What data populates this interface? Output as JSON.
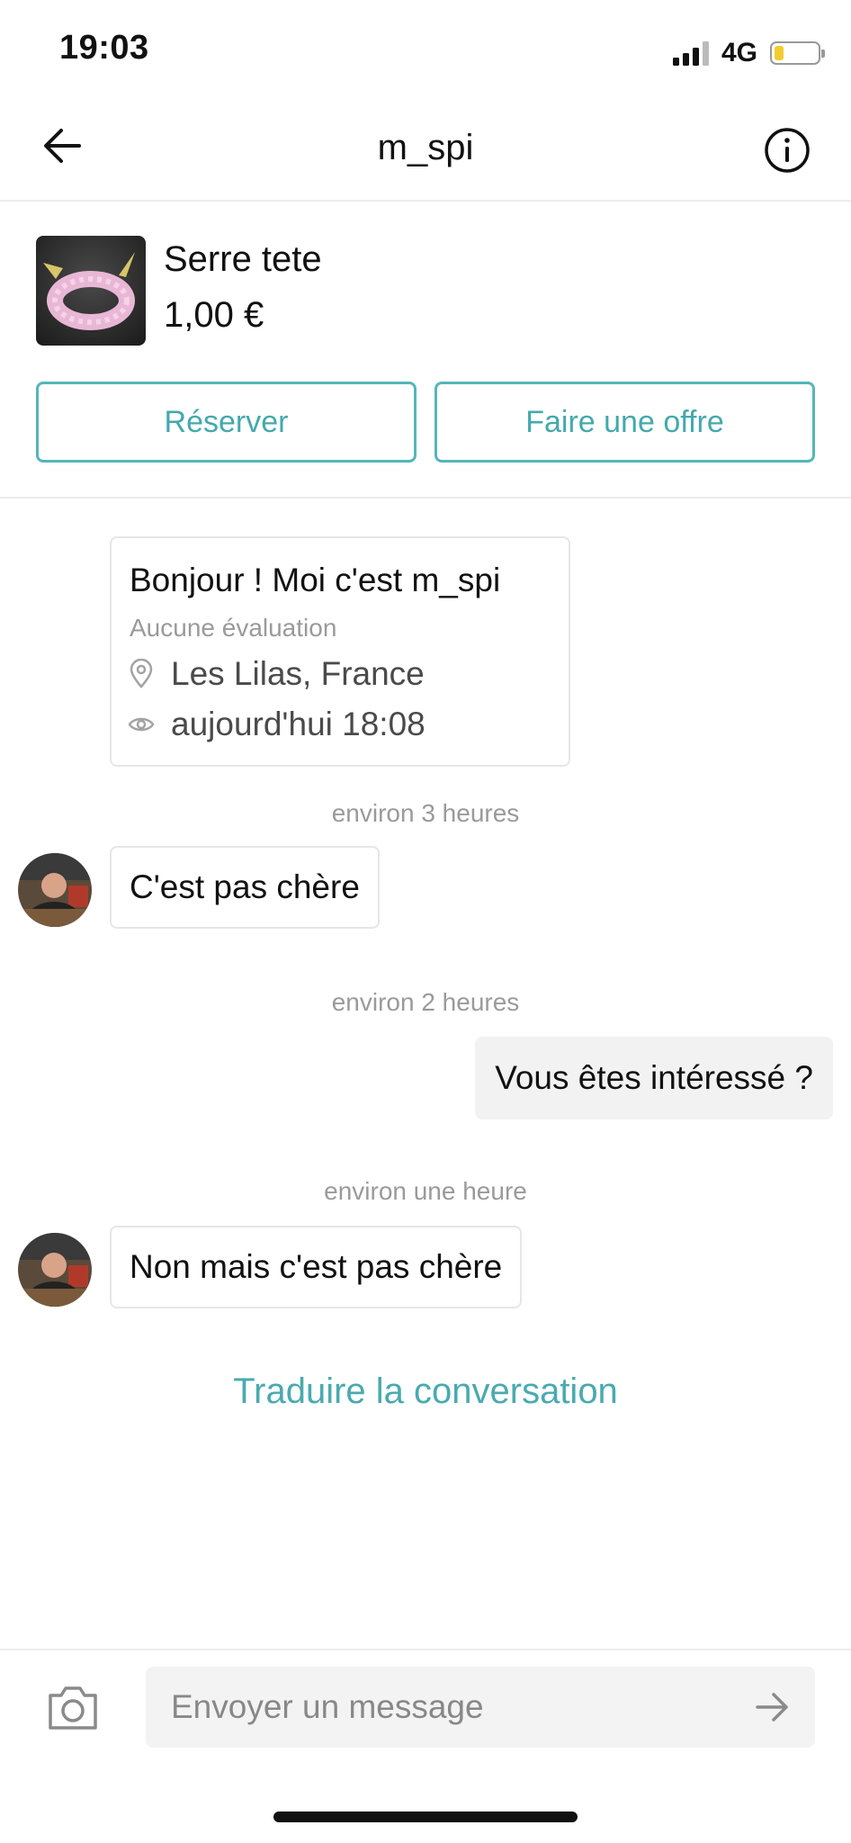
{
  "status_bar": {
    "time": "19:03",
    "network": "4G"
  },
  "header": {
    "title": "m_spi",
    "back_icon": "arrow-left-icon",
    "info_icon": "info-circle-icon"
  },
  "product": {
    "title": "Serre tete",
    "price": "1,00 €",
    "reserve_label": "Réserver",
    "offer_label": "Faire une offre"
  },
  "profile_card": {
    "greeting": "Bonjour ! Moi c'est m_spi",
    "rating": "Aucune évaluation",
    "location": "Les Lilas, France",
    "last_seen": "aujourd'hui 18:08"
  },
  "messages": [
    {
      "timestamp": "environ 3 heures",
      "direction": "in",
      "text": "C'est pas chère"
    },
    {
      "timestamp": "environ 2 heures",
      "direction": "out",
      "text": "Vous êtes intéressé ?"
    },
    {
      "timestamp": "environ une heure",
      "direction": "in",
      "text": "Non mais c'est pas chère"
    }
  ],
  "translate_link": "Traduire la conversation",
  "composer": {
    "placeholder": "Envoyer un message",
    "camera_icon": "camera-icon",
    "send_icon": "send-arrow-icon"
  },
  "colors": {
    "accent": "#54b6ba",
    "accent_text": "#44a9ad",
    "muted_text": "#9a9a9a",
    "outgoing_bubble": "#f2f2f2"
  }
}
